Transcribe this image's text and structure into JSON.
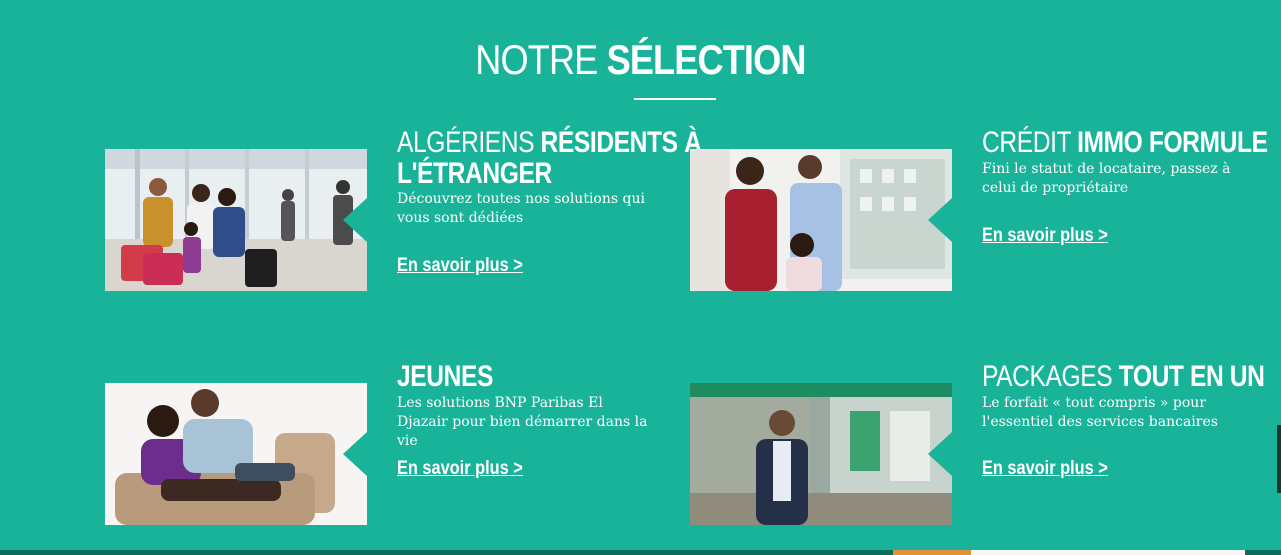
{
  "section": {
    "title_light": "NOTRE ",
    "title_bold": "SÉLECTION"
  },
  "cards": [
    {
      "title_light": "ALGÉRIENS ",
      "title_bold": "RÉSIDENTS À",
      "title_line2": "L'ÉTRANGER",
      "description": "Découvrez toutes nos solutions qui vous sont dédiées",
      "link": "En savoir plus >"
    },
    {
      "title_light": "CRÉDIT ",
      "title_bold": "IMMO FORMULE",
      "description": "Fini le statut de locataire, passez à celui de propriétaire",
      "link": "En savoir plus >"
    },
    {
      "title_bold": "JEUNES",
      "description": "Les solutions BNP Paribas El Djazair pour bien démarrer dans la vie",
      "link": "En savoir plus >"
    },
    {
      "title_light": "PACKAGES ",
      "title_bold": "TOUT EN UN",
      "description": "Le forfait « tout compris » pour l'essentiel des services bancaires",
      "link": "En savoir plus >"
    }
  ],
  "colors": {
    "background": "#19b39a",
    "footer": "#0b6e5d",
    "accent_orange": "#e1913a"
  }
}
